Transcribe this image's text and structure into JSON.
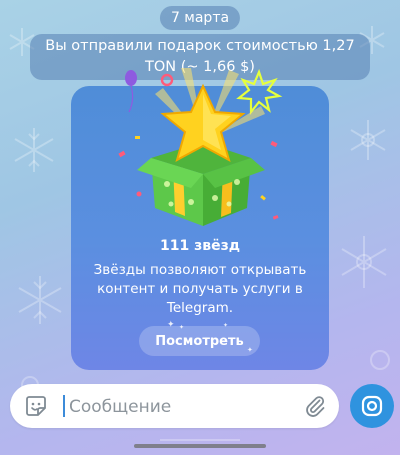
{
  "chat": {
    "date_label": "7 марта",
    "service_message": "Вы отправили подарок стоимостью 1,27 TON (~ 1,66 $)"
  },
  "gift": {
    "stars_count": "111 звёзд",
    "description": "Звёзды позволяют открывать контент и получать услуги в Telegram.",
    "view_button_label": "Посмотреть"
  },
  "composer": {
    "placeholder": "Сообщение",
    "value": ""
  },
  "icons": {
    "sticker": "sticker-icon",
    "attach": "paperclip-icon",
    "camera": "camera-icon"
  },
  "colors": {
    "accent": "#2f93df",
    "card_top": "#4f8dd8",
    "card_bottom": "#6e86e6"
  }
}
